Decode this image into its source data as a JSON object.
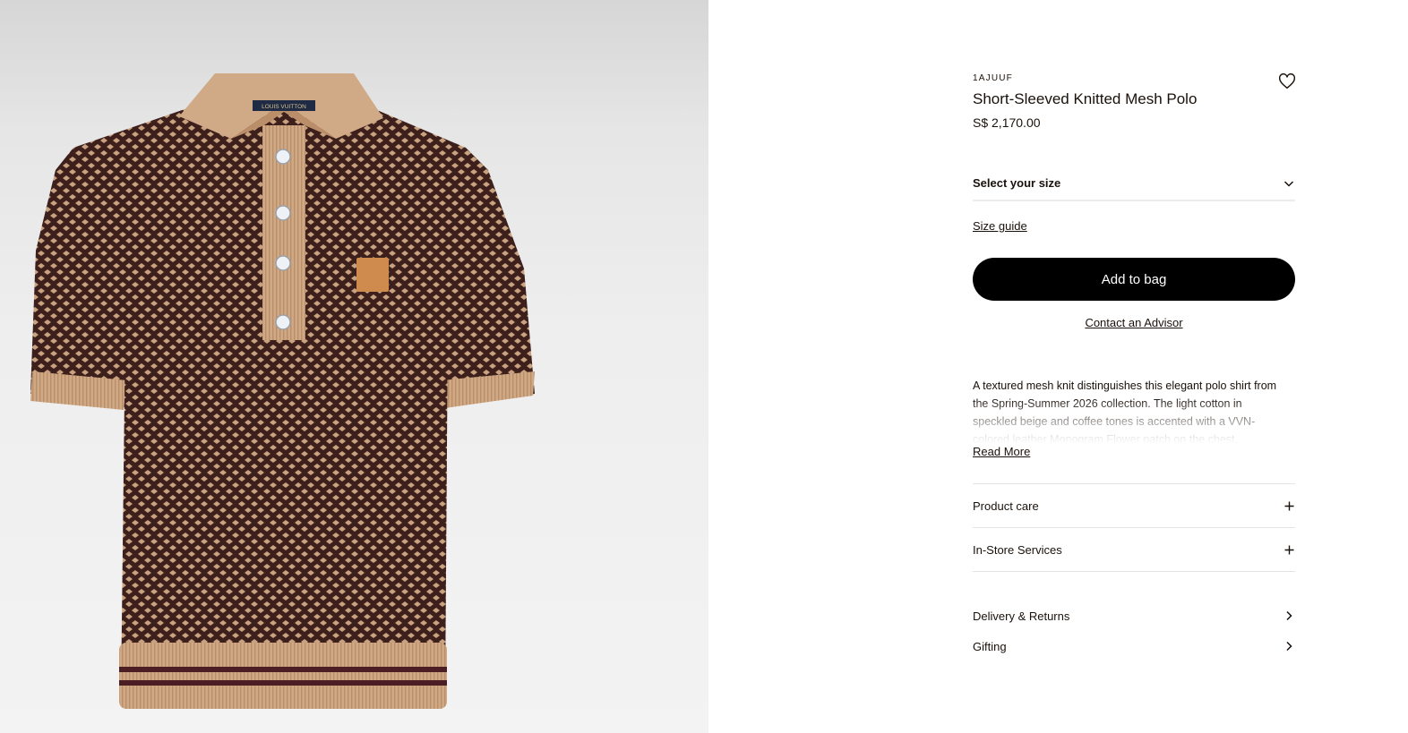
{
  "product": {
    "sku": "1AJUUF",
    "name": "Short-Sleeved Knitted Mesh Polo",
    "price": "S$ 2,170.00",
    "collar_label_text": "LOUIS VUITTON"
  },
  "icons": {
    "wishlist": "heart-outline-icon",
    "size_select": "chevron-down-icon",
    "accordion": "plus-icon",
    "link": "chevron-right-icon"
  },
  "size": {
    "placeholder": "Select your size"
  },
  "actions": {
    "size_guide": "Size guide",
    "add_to_bag": "Add to bag",
    "contact_advisor": "Contact an Advisor",
    "read_more": "Read More"
  },
  "description": "A textured mesh knit distinguishes this elegant polo shirt from the Spring-Summer 2026 collection. The light cotton in speckled beige and coffee tones is accented with a VVN-colored leather Monogram Flower patch on the chest.",
  "accordions": [
    {
      "label": "Product care"
    },
    {
      "label": "In-Store Services"
    }
  ],
  "links": [
    {
      "label": "Delivery & Returns"
    },
    {
      "label": "Gifting"
    }
  ],
  "colors": {
    "knit_beige": "#c9a27f",
    "knit_dark": "#3d1f1c",
    "patch": "#cf8a4e",
    "button_black": "#000000"
  }
}
